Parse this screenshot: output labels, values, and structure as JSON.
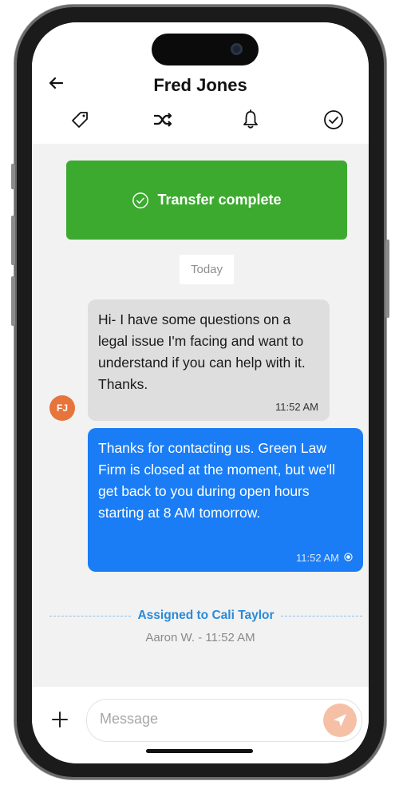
{
  "header": {
    "title": "Fred Jones",
    "icons": [
      "back-arrow-icon",
      "tag-icon",
      "shuffle-icon",
      "bell-icon",
      "check-circle-icon"
    ]
  },
  "banner": {
    "text": "Transfer complete",
    "color": "#3caa2f"
  },
  "date_separator": "Today",
  "messages": [
    {
      "direction": "incoming",
      "text": "Hi- I have some questions on a legal issue I'm facing and want to understand if you can help with it. Thanks.",
      "time": "11:52 AM",
      "avatar_initials": "FJ",
      "bubble_color": "#dedede"
    },
    {
      "direction": "outgoing",
      "text": "Thanks for contacting us. Green Law Firm is closed at the moment, but we'll get back to you during open hours starting at 8 AM tomorrow.",
      "time": "11:52 AM",
      "bubble_color": "#1a7df5"
    }
  ],
  "assignment": {
    "text": "Assigned to Cali Taylor",
    "meta": "Aaron W. - 11:52 AM"
  },
  "composer": {
    "placeholder": "Message",
    "value": ""
  },
  "colors": {
    "accent": "#1a7df5",
    "avatar": "#e7743a",
    "send": "#f6c0a6",
    "assigned": "#2a8ad8"
  }
}
